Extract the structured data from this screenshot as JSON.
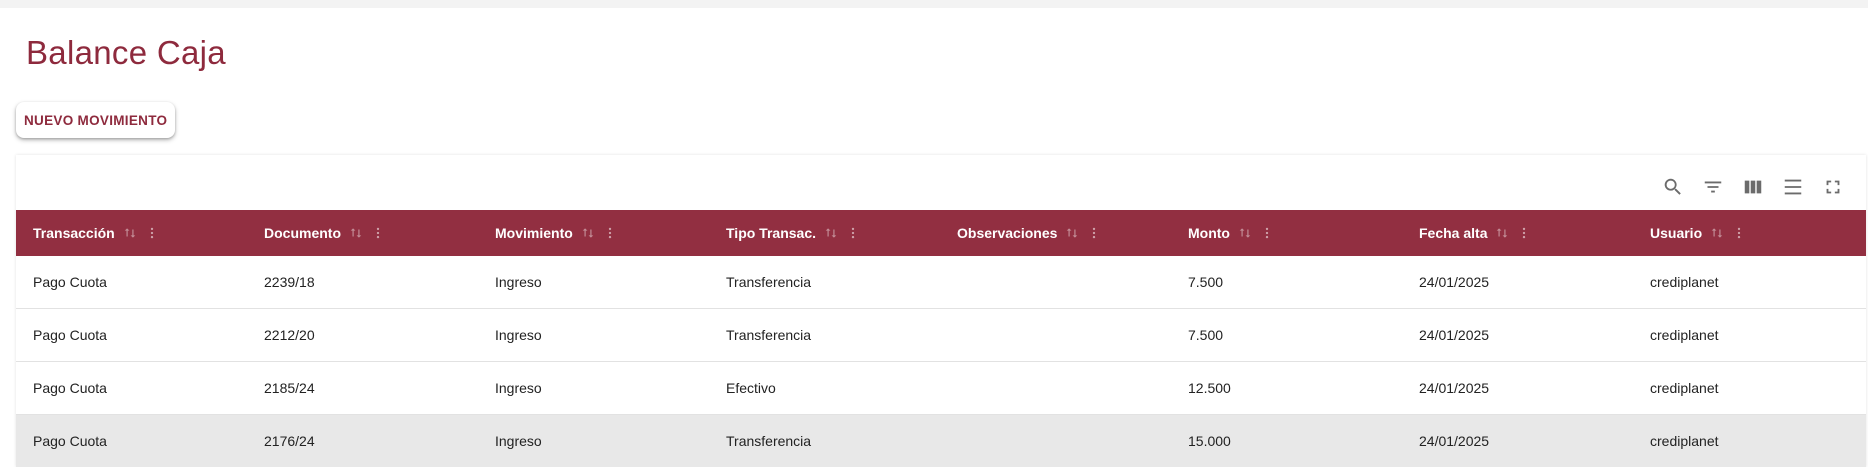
{
  "page": {
    "title": "Balance Caja"
  },
  "actions": {
    "new_movement_label": "NUEVO MOVIMIENTO"
  },
  "toolbar": {
    "icons": [
      "search-icon",
      "filter-icon",
      "columns-icon",
      "density-icon",
      "fullscreen-icon"
    ]
  },
  "table": {
    "headers": [
      "Transacción",
      "Documento",
      "Movimiento",
      "Tipo Transac.",
      "Observaciones",
      "Monto",
      "Fecha alta",
      "Usuario"
    ],
    "rows": [
      [
        "Pago Cuota",
        "2239/18",
        "Ingreso",
        "Transferencia",
        "",
        "7.500",
        "24/01/2025",
        "crediplanet"
      ],
      [
        "Pago Cuota",
        "2212/20",
        "Ingreso",
        "Transferencia",
        "",
        "7.500",
        "24/01/2025",
        "crediplanet"
      ],
      [
        "Pago Cuota",
        "2185/24",
        "Ingreso",
        "Efectivo",
        "",
        "12.500",
        "24/01/2025",
        "crediplanet"
      ],
      [
        "Pago Cuota",
        "2176/24",
        "Ingreso",
        "Transferencia",
        "",
        "15.000",
        "24/01/2025",
        "crediplanet"
      ]
    ],
    "highlighted_row": 3
  },
  "colors": {
    "accent": "#922f41",
    "title": "#8e2a3d"
  }
}
